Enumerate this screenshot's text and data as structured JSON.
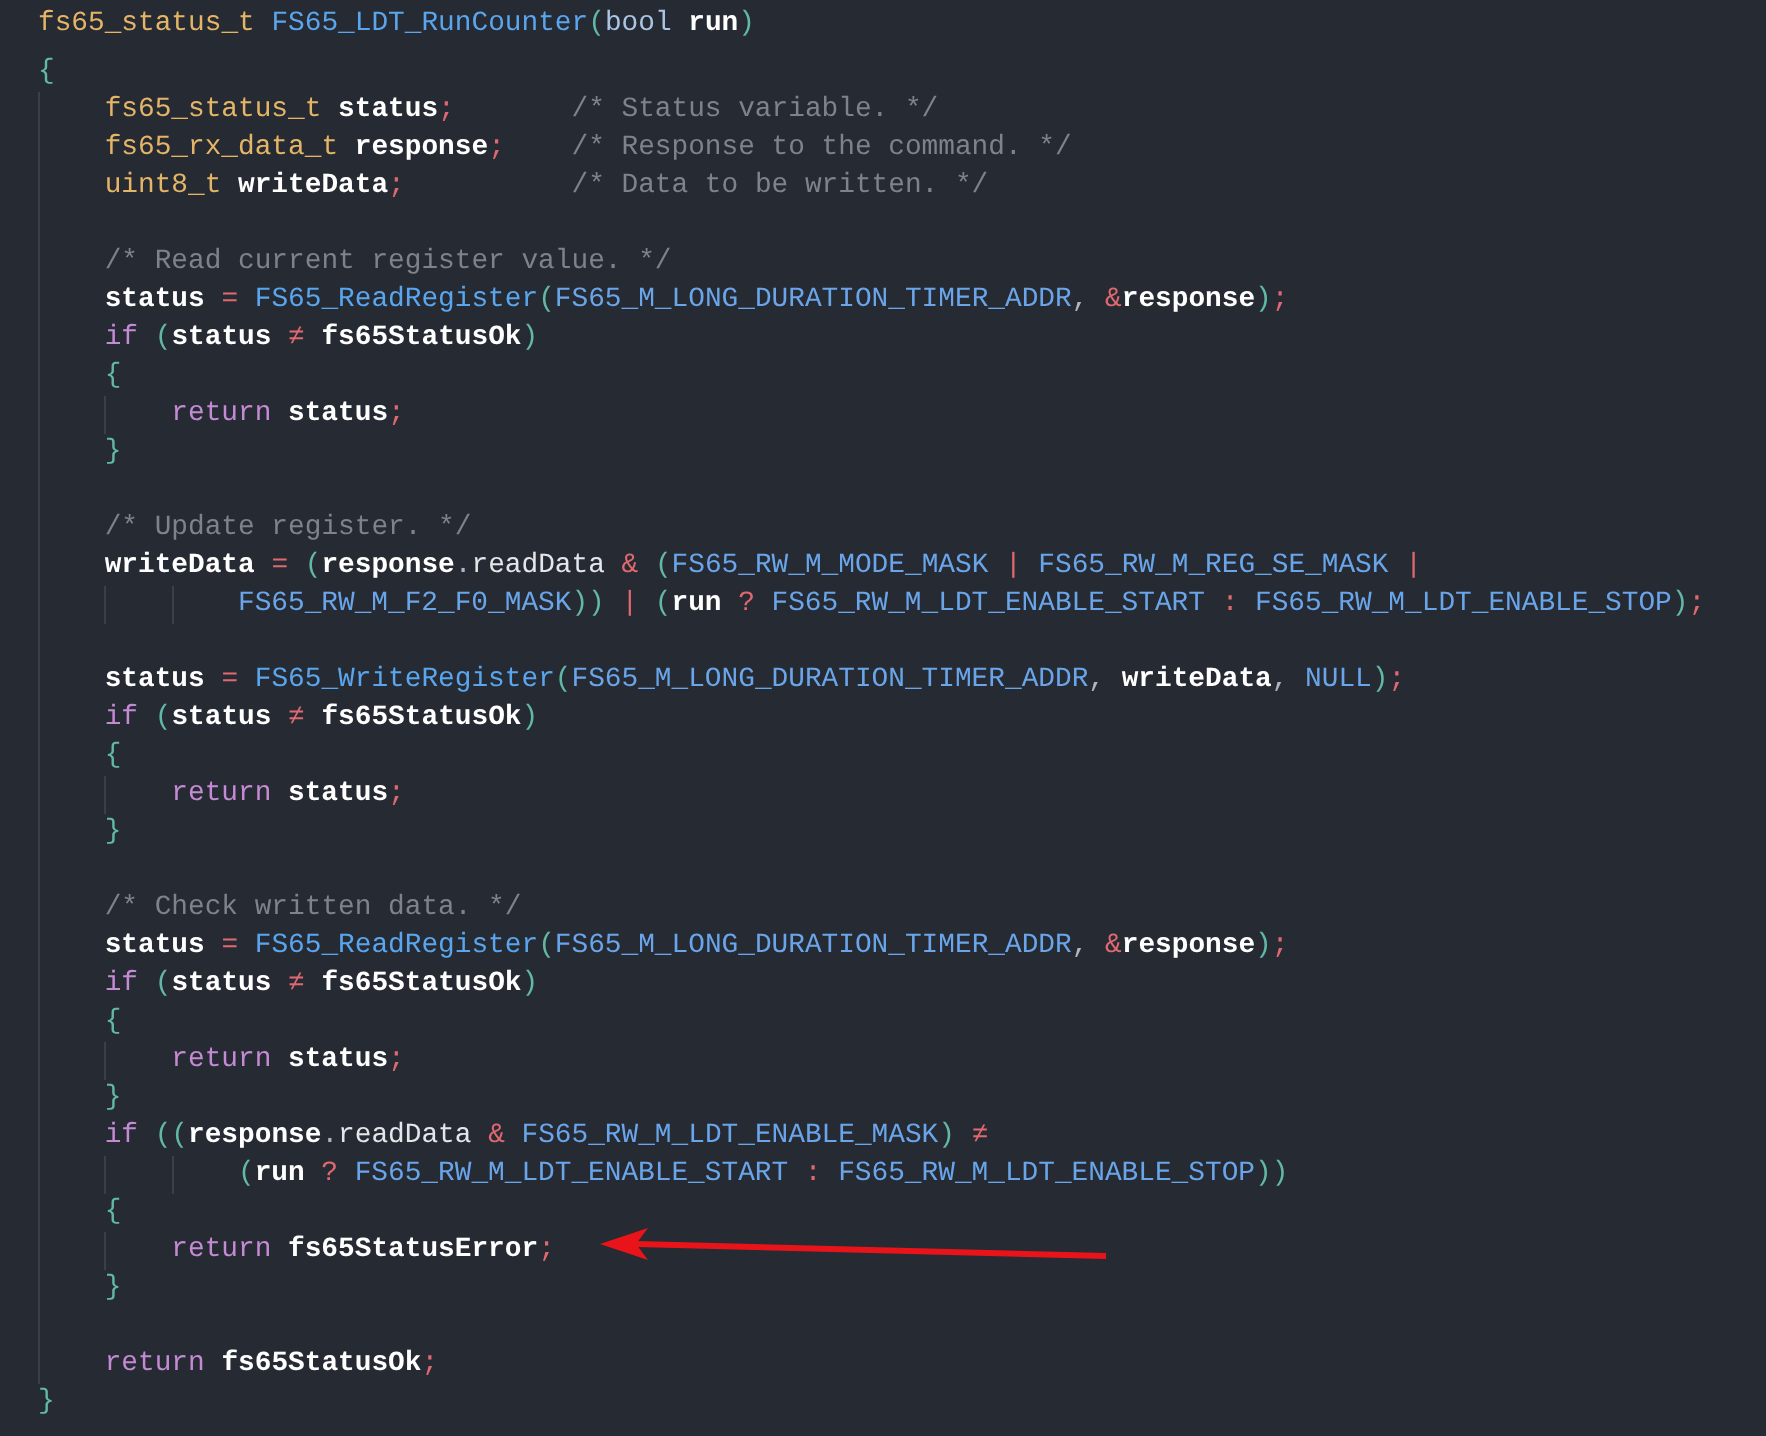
{
  "editor": {
    "lines": [
      {
        "kind": "code",
        "tokens": [
          {
            "kind": "type",
            "text": "fs65_status_t "
          },
          {
            "kind": "func",
            "text": "FS65_LDT_RunCounter"
          },
          {
            "kind": "paren",
            "text": "("
          },
          {
            "kind": "builtin",
            "text": "bool "
          },
          {
            "kind": "var",
            "text": "run"
          },
          {
            "kind": "paren",
            "text": ")"
          }
        ]
      },
      {
        "kind": "code",
        "tokens": [
          {
            "kind": "paren",
            "text": "{"
          }
        ],
        "children": [
          {
            "kind": "code",
            "tokens": [
              {
                "kind": "type",
                "text": "fs65_status_t "
              },
              {
                "kind": "var",
                "text": "status"
              },
              {
                "kind": "op",
                "text": ";"
              },
              {
                "kind": "comment",
                "text": "       /* Status variable. */"
              }
            ]
          },
          {
            "kind": "code",
            "tokens": [
              {
                "kind": "type",
                "text": "fs65_rx_data_t "
              },
              {
                "kind": "var",
                "text": "response"
              },
              {
                "kind": "op",
                "text": ";"
              },
              {
                "kind": "comment",
                "text": "    /* Response to the command. */"
              }
            ]
          },
          {
            "kind": "code",
            "tokens": [
              {
                "kind": "type",
                "text": "uint8_t "
              },
              {
                "kind": "var",
                "text": "writeData"
              },
              {
                "kind": "op",
                "text": ";"
              },
              {
                "kind": "comment",
                "text": "          /* Data to be written. */"
              }
            ]
          },
          {
            "kind": "blank"
          },
          {
            "kind": "code",
            "tokens": [
              {
                "kind": "comment",
                "text": "/* Read current register value. */"
              }
            ]
          },
          {
            "kind": "code",
            "tokens": [
              {
                "kind": "var",
                "text": "status "
              },
              {
                "kind": "op",
                "text": "= "
              },
              {
                "kind": "func",
                "text": "FS65_ReadRegister"
              },
              {
                "kind": "paren",
                "text": "("
              },
              {
                "kind": "macro",
                "text": "FS65_M_LONG_DURATION_TIMER_ADDR"
              },
              {
                "kind": "punct",
                "text": ", "
              },
              {
                "kind": "op",
                "text": "&"
              },
              {
                "kind": "var",
                "text": "response"
              },
              {
                "kind": "paren",
                "text": ")"
              },
              {
                "kind": "op",
                "text": ";"
              }
            ]
          },
          {
            "kind": "code",
            "tokens": [
              {
                "kind": "kw",
                "text": "if "
              },
              {
                "kind": "paren",
                "text": "("
              },
              {
                "kind": "var",
                "text": "status "
              },
              {
                "kind": "op",
                "text": "≠ "
              },
              {
                "kind": "var",
                "text": "fs65StatusOk"
              },
              {
                "kind": "paren",
                "text": ")"
              }
            ]
          },
          {
            "kind": "code",
            "tokens": [
              {
                "kind": "paren",
                "text": "{"
              }
            ],
            "children": [
              {
                "kind": "code",
                "tokens": [
                  {
                    "kind": "kw",
                    "text": "return "
                  },
                  {
                    "kind": "var",
                    "text": "status"
                  },
                  {
                    "kind": "op",
                    "text": ";"
                  }
                ]
              }
            ]
          },
          {
            "kind": "code",
            "tokens": [
              {
                "kind": "paren",
                "text": "}"
              }
            ]
          },
          {
            "kind": "blank"
          },
          {
            "kind": "code",
            "tokens": [
              {
                "kind": "comment",
                "text": "/* Update register. */"
              }
            ]
          },
          {
            "kind": "code",
            "tokens": [
              {
                "kind": "var",
                "text": "writeData "
              },
              {
                "kind": "op",
                "text": "= "
              },
              {
                "kind": "paren",
                "text": "("
              },
              {
                "kind": "var",
                "text": "response"
              },
              {
                "kind": "punct",
                "text": "."
              },
              {
                "kind": "field",
                "text": "readData "
              },
              {
                "kind": "op",
                "text": "& "
              },
              {
                "kind": "paren",
                "text": "("
              },
              {
                "kind": "macro",
                "text": "FS65_RW_M_MODE_MASK "
              },
              {
                "kind": "op",
                "text": "| "
              },
              {
                "kind": "macro",
                "text": "FS65_RW_M_REG_SE_MASK "
              },
              {
                "kind": "op",
                "text": "|"
              }
            ],
            "children": [
              {
                "kind": "continuation",
                "tokens": [
                  {
                    "kind": "macro",
                    "text": "FS65_RW_M_F2_F0_MASK"
                  },
                  {
                    "kind": "paren",
                    "text": ")) "
                  },
                  {
                    "kind": "op",
                    "text": "| "
                  },
                  {
                    "kind": "paren",
                    "text": "("
                  },
                  {
                    "kind": "var",
                    "text": "run "
                  },
                  {
                    "kind": "op",
                    "text": "? "
                  },
                  {
                    "kind": "macro",
                    "text": "FS65_RW_M_LDT_ENABLE_START "
                  },
                  {
                    "kind": "op",
                    "text": ": "
                  },
                  {
                    "kind": "macro",
                    "text": "FS65_RW_M_LDT_ENABLE_STOP"
                  },
                  {
                    "kind": "paren",
                    "text": ")"
                  },
                  {
                    "kind": "op",
                    "text": ";"
                  }
                ]
              }
            ]
          },
          {
            "kind": "blank"
          },
          {
            "kind": "code",
            "tokens": [
              {
                "kind": "var",
                "text": "status "
              },
              {
                "kind": "op",
                "text": "= "
              },
              {
                "kind": "func",
                "text": "FS65_WriteRegister"
              },
              {
                "kind": "paren",
                "text": "("
              },
              {
                "kind": "macro",
                "text": "FS65_M_LONG_DURATION_TIMER_ADDR"
              },
              {
                "kind": "punct",
                "text": ", "
              },
              {
                "kind": "var",
                "text": "writeData"
              },
              {
                "kind": "punct",
                "text": ", "
              },
              {
                "kind": "macro",
                "text": "NULL"
              },
              {
                "kind": "paren",
                "text": ")"
              },
              {
                "kind": "op",
                "text": ";"
              }
            ]
          },
          {
            "kind": "code",
            "tokens": [
              {
                "kind": "kw",
                "text": "if "
              },
              {
                "kind": "paren",
                "text": "("
              },
              {
                "kind": "var",
                "text": "status "
              },
              {
                "kind": "op",
                "text": "≠ "
              },
              {
                "kind": "var",
                "text": "fs65StatusOk"
              },
              {
                "kind": "paren",
                "text": ")"
              }
            ]
          },
          {
            "kind": "code",
            "tokens": [
              {
                "kind": "paren",
                "text": "{"
              }
            ],
            "children": [
              {
                "kind": "code",
                "tokens": [
                  {
                    "kind": "kw",
                    "text": "return "
                  },
                  {
                    "kind": "var",
                    "text": "status"
                  },
                  {
                    "kind": "op",
                    "text": ";"
                  }
                ]
              }
            ]
          },
          {
            "kind": "code",
            "tokens": [
              {
                "kind": "paren",
                "text": "}"
              }
            ]
          },
          {
            "kind": "blank"
          },
          {
            "kind": "code",
            "tokens": [
              {
                "kind": "comment",
                "text": "/* Check written data. */"
              }
            ]
          },
          {
            "kind": "code",
            "tokens": [
              {
                "kind": "var",
                "text": "status "
              },
              {
                "kind": "op",
                "text": "= "
              },
              {
                "kind": "func",
                "text": "FS65_ReadRegister"
              },
              {
                "kind": "paren",
                "text": "("
              },
              {
                "kind": "macro",
                "text": "FS65_M_LONG_DURATION_TIMER_ADDR"
              },
              {
                "kind": "punct",
                "text": ", "
              },
              {
                "kind": "op",
                "text": "&"
              },
              {
                "kind": "var",
                "text": "response"
              },
              {
                "kind": "paren",
                "text": ")"
              },
              {
                "kind": "op",
                "text": ";"
              }
            ]
          },
          {
            "kind": "code",
            "tokens": [
              {
                "kind": "kw",
                "text": "if "
              },
              {
                "kind": "paren",
                "text": "("
              },
              {
                "kind": "var",
                "text": "status "
              },
              {
                "kind": "op",
                "text": "≠ "
              },
              {
                "kind": "var",
                "text": "fs65StatusOk"
              },
              {
                "kind": "paren",
                "text": ")"
              }
            ]
          },
          {
            "kind": "code",
            "tokens": [
              {
                "kind": "paren",
                "text": "{"
              }
            ],
            "children": [
              {
                "kind": "code",
                "tokens": [
                  {
                    "kind": "kw",
                    "text": "return "
                  },
                  {
                    "kind": "var",
                    "text": "status"
                  },
                  {
                    "kind": "op",
                    "text": ";"
                  }
                ]
              }
            ]
          },
          {
            "kind": "code",
            "tokens": [
              {
                "kind": "paren",
                "text": "}"
              }
            ]
          },
          {
            "kind": "code",
            "tokens": [
              {
                "kind": "kw",
                "text": "if "
              },
              {
                "kind": "paren",
                "text": "(("
              },
              {
                "kind": "var",
                "text": "response"
              },
              {
                "kind": "punct",
                "text": "."
              },
              {
                "kind": "field",
                "text": "readData "
              },
              {
                "kind": "op",
                "text": "& "
              },
              {
                "kind": "macro",
                "text": "FS65_RW_M_LDT_ENABLE_MASK"
              },
              {
                "kind": "paren",
                "text": ") "
              },
              {
                "kind": "op",
                "text": "≠"
              }
            ],
            "children": [
              {
                "kind": "continuation",
                "tokens": [
                  {
                    "kind": "paren",
                    "text": "("
                  },
                  {
                    "kind": "var",
                    "text": "run "
                  },
                  {
                    "kind": "op",
                    "text": "? "
                  },
                  {
                    "kind": "macro",
                    "text": "FS65_RW_M_LDT_ENABLE_START "
                  },
                  {
                    "kind": "op",
                    "text": ": "
                  },
                  {
                    "kind": "macro",
                    "text": "FS65_RW_M_LDT_ENABLE_STOP"
                  },
                  {
                    "kind": "paren",
                    "text": "))"
                  }
                ]
              }
            ]
          },
          {
            "kind": "code",
            "tokens": [
              {
                "kind": "paren",
                "text": "{"
              }
            ],
            "children": [
              {
                "kind": "code",
                "tokens": [
                  {
                    "kind": "kw",
                    "text": "return "
                  },
                  {
                    "kind": "var",
                    "text": "fs65StatusError"
                  },
                  {
                    "kind": "op",
                    "text": ";"
                  }
                ]
              }
            ]
          },
          {
            "kind": "code",
            "tokens": [
              {
                "kind": "paren",
                "text": "}"
              }
            ]
          },
          {
            "kind": "blank"
          },
          {
            "kind": "code",
            "tokens": [
              {
                "kind": "kw",
                "text": "return "
              },
              {
                "kind": "var",
                "text": "fs65StatusOk"
              },
              {
                "kind": "op",
                "text": ";"
              }
            ]
          }
        ]
      },
      {
        "kind": "code",
        "tokens": [
          {
            "kind": "paren",
            "text": "}"
          }
        ]
      }
    ]
  }
}
